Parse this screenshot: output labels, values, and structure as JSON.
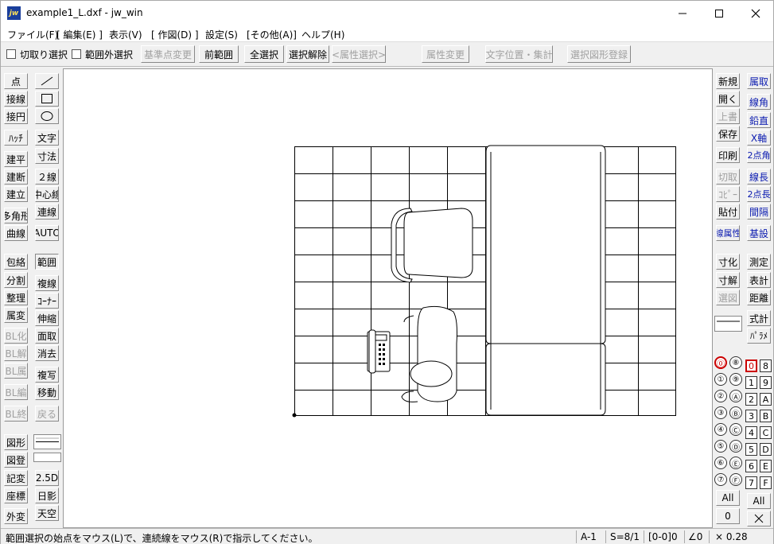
{
  "title": {
    "icon": "jw",
    "text": "example1_L.dxf - jw_win"
  },
  "window": {
    "minimize_icon": "minimize-icon",
    "maximize_icon": "maximize-icon",
    "close_icon": "close-icon"
  },
  "menu": [
    "ファイル(F)",
    "[ 編集(E) ]",
    "表示(V)",
    "[ 作図(D) ]",
    "設定(S)",
    "[その他(A)]",
    "ヘルプ(H)"
  ],
  "toolbar": {
    "check1": "切取り選択",
    "check2": "範囲外選択",
    "buttons": [
      "基準点変更",
      "前範囲",
      "全選択",
      "選択解除",
      "<属性選択>",
      "属性変更",
      "文字位置・集計",
      "選択図形登録"
    ]
  },
  "left_col1": [
    "点",
    "接線",
    "接円",
    "ﾊｯﾁ",
    "建平",
    "建断",
    "建立",
    "多角形",
    "曲線",
    "包絡",
    "分割",
    "整理",
    "属変",
    "BL化",
    "BL解",
    "BL属",
    "BL編",
    "BL終",
    "図形",
    "図登",
    "記変",
    "座標",
    "外変"
  ],
  "left_col2": [
    "文字",
    "寸法",
    "２線",
    "中心線",
    "連線",
    "AUTO",
    "範囲",
    "複線",
    "ｺｰﾅｰ",
    "伸縮",
    "面取",
    "消去",
    "複写",
    "移動",
    "戻る",
    "2.5D",
    "日影",
    "天空"
  ],
  "right_col1": [
    "新規",
    "開く",
    "上書",
    "保存",
    "印刷",
    "切取",
    "ｺﾋﾟｰ",
    "貼付",
    "線属性",
    "寸化",
    "寸解",
    "選図"
  ],
  "right_col2": [
    "属取",
    "線角",
    "鉛直",
    "X軸",
    "2点角",
    "線長",
    "2点長",
    "間隔",
    "基設",
    "測定",
    "表計",
    "距離",
    "式計",
    "ﾊﾟﾗﾒ"
  ],
  "layers": {
    "groups": [
      "0",
      "8",
      "1",
      "9",
      "2",
      "A",
      "3",
      "B",
      "4",
      "C",
      "5",
      "D",
      "6",
      "E",
      "7",
      "F"
    ],
    "group_circles": [
      "⓪",
      "⑧",
      "①",
      "⑨",
      "②",
      "Ⓐ",
      "③",
      "Ⓑ",
      "④",
      "Ⓒ",
      "⑤",
      "Ⓓ",
      "⑥",
      "Ⓔ",
      "⑦",
      "Ⓕ"
    ],
    "all": "All",
    "zero": "0",
    "x_icon": "close-x-icon"
  },
  "status": {
    "message": "範囲選択の始点をマウス(L)で、連続線をマウス(R)で指示してください。",
    "paper": "A-1",
    "scale": "S=8/1",
    "layer": "[0-0]0",
    "angle": "∠0",
    "zoom": "× 0.28"
  }
}
